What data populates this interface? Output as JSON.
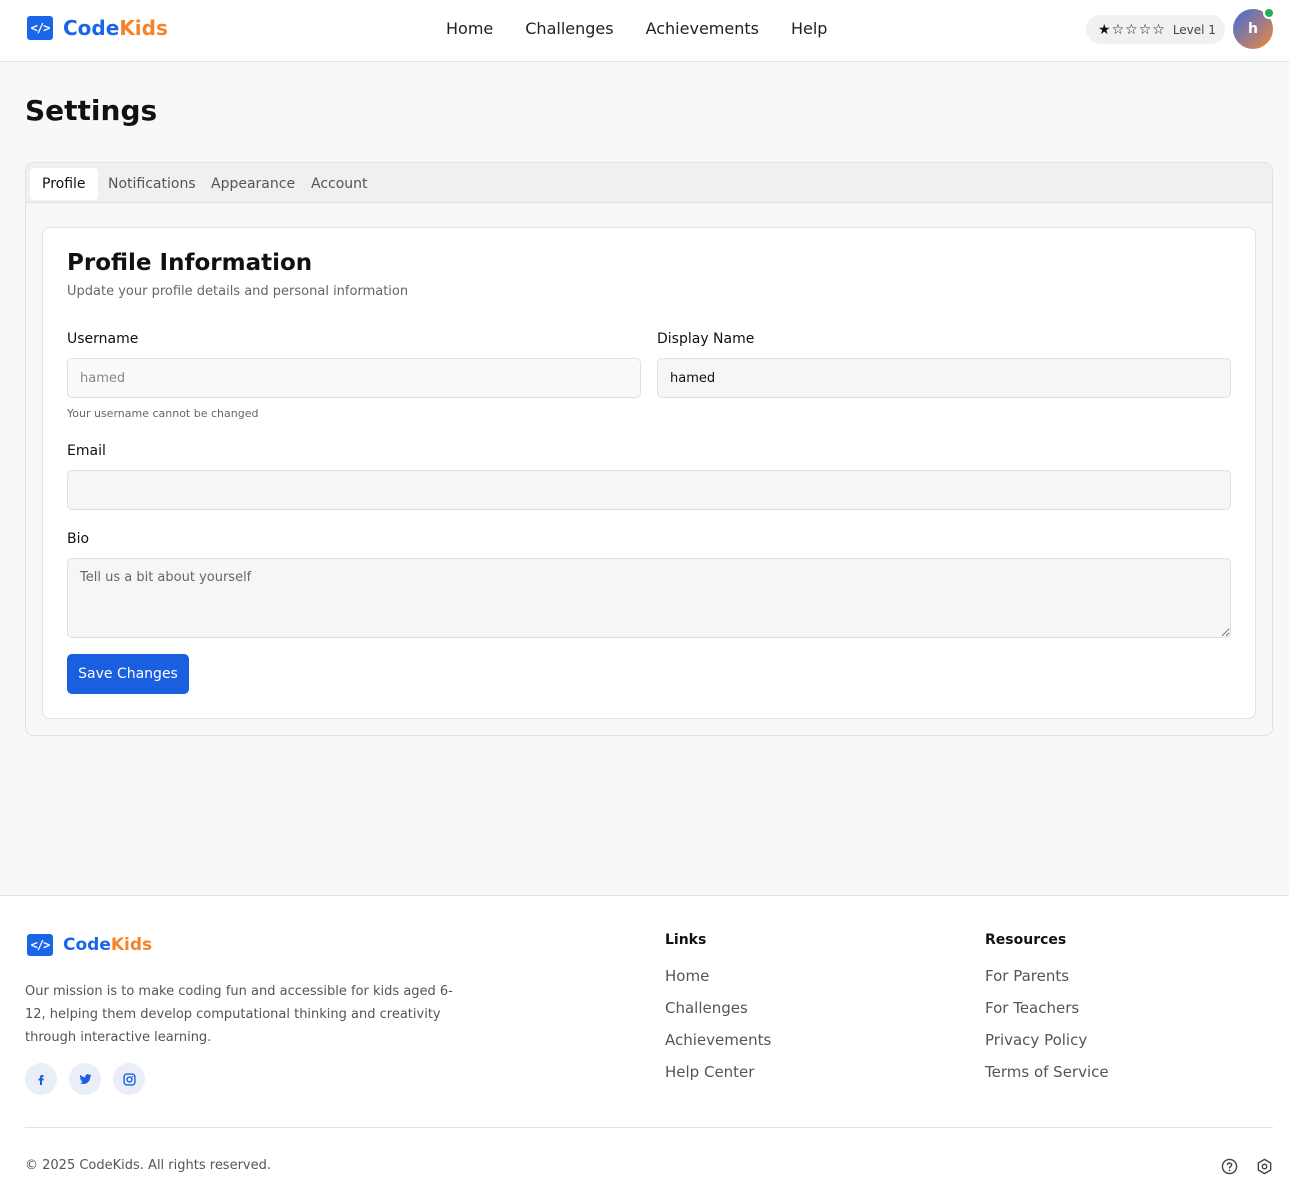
{
  "app": {
    "brand_code": "Code",
    "brand_kids": "Kids",
    "logo_glyph": "</>"
  },
  "nav": {
    "items": [
      {
        "label": "Home"
      },
      {
        "label": "Challenges"
      },
      {
        "label": "Achievements"
      },
      {
        "label": "Help"
      }
    ]
  },
  "user": {
    "stars_total": 5,
    "stars_filled": 1,
    "level_label": "Level 1",
    "avatar_initial": "h",
    "online": true
  },
  "page": {
    "title": "Settings"
  },
  "tabs": [
    {
      "label": "Profile",
      "active": true
    },
    {
      "label": "Notifications",
      "active": false
    },
    {
      "label": "Appearance",
      "active": false
    },
    {
      "label": "Account",
      "active": false
    }
  ],
  "profile": {
    "title": "Profile Information",
    "subtitle": "Update your profile details and personal information",
    "username": {
      "label": "Username",
      "placeholder": "hamed",
      "hint": "Your username cannot be changed"
    },
    "display_name": {
      "label": "Display Name",
      "value": "hamed"
    },
    "email": {
      "label": "Email",
      "value": ""
    },
    "bio": {
      "label": "Bio",
      "placeholder": "Tell us a bit about yourself"
    },
    "save_label": "Save Changes"
  },
  "footer": {
    "mission": "Our mission is to make coding fun and accessible for kids aged 6-12, helping them develop computational thinking and creativity through interactive learning.",
    "links_title": "Links",
    "links": [
      "Home",
      "Challenges",
      "Achievements",
      "Help Center"
    ],
    "resources_title": "Resources",
    "resources": [
      "For Parents",
      "For Teachers",
      "Privacy Policy",
      "Terms of Service"
    ],
    "socials": [
      "facebook-icon",
      "twitter-icon",
      "instagram-icon"
    ],
    "copyright": "© 2025 CodeKids. All rights reserved."
  },
  "colors": {
    "primary": "#1a5fe0",
    "brand_blue": "#1a66e8",
    "brand_orange": "#f5832a",
    "online": "#1bb25a"
  }
}
